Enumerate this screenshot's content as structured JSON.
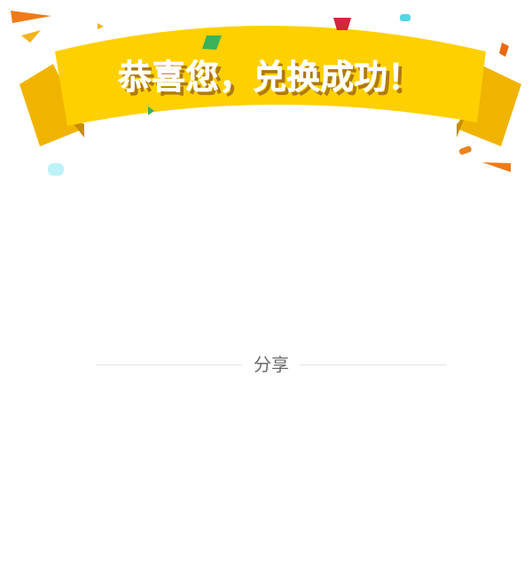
{
  "banner": {
    "title": "恭喜您，兑换成功！",
    "colors": {
      "ribbon_front": "#ffd000",
      "ribbon_back": "#f0b400",
      "ribbon_fold": "#c98d00",
      "text": "#ffffff",
      "text_shadow": "#b07a10"
    }
  },
  "share": {
    "label": "分享",
    "line_color": "#e4e4e4",
    "label_color": "#6a6a6a"
  }
}
